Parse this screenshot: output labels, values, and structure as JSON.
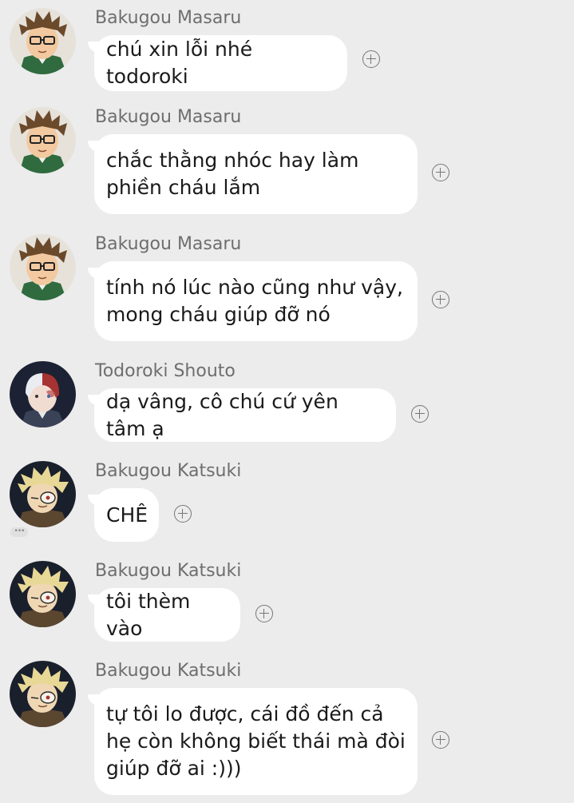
{
  "colors": {
    "background": "#ececec",
    "bubble": "#ffffff",
    "sender_name": "#6e6e6e",
    "message_text": "#1a1a1a"
  },
  "messages": [
    {
      "sender": "Bakugou Masaru",
      "avatar": "masaru-avatar",
      "text": "chú xin lỗi nhé todoroki"
    },
    {
      "sender": "Bakugou Masaru",
      "avatar": "masaru-avatar",
      "text": "chắc thằng nhóc hay làm\nphiền cháu lắm"
    },
    {
      "sender": "Bakugou Masaru",
      "avatar": "masaru-avatar",
      "text": "tính nó lúc nào cũng như vậy,\nmong cháu giúp đỡ nó"
    },
    {
      "sender": "Todoroki Shouto",
      "avatar": "shouto-avatar",
      "text": "dạ vâng, cô chú cứ yên tâm ạ"
    },
    {
      "sender": "Bakugou Katsuki",
      "avatar": "katsuki-avatar",
      "text": "CHÊ"
    },
    {
      "sender": "Bakugou Katsuki",
      "avatar": "katsuki-avatar",
      "text": "tôi thèm vào"
    },
    {
      "sender": "Bakugou Katsuki",
      "avatar": "katsuki-avatar",
      "text": "tự tôi lo được, cái đồ đến cả\nhẹ còn không biết thái mà đòi\ngiúp đỡ ai :)))"
    }
  ],
  "typing_indicator": "•••"
}
